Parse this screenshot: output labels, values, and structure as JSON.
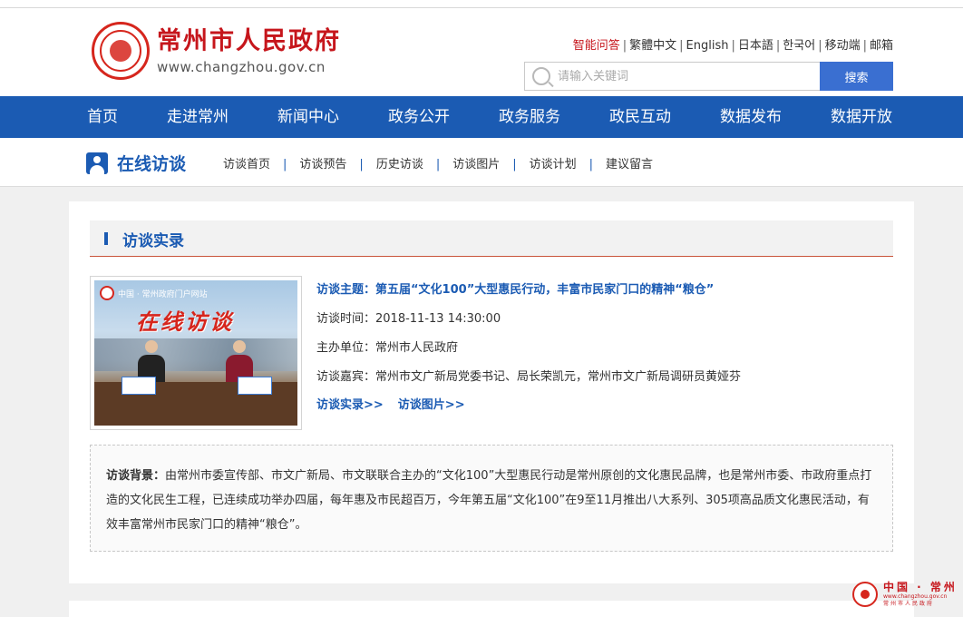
{
  "site": {
    "title_cn": "常州市人民政府",
    "url": "www.changzhou.gov.cn"
  },
  "toplinks": [
    "智能问答",
    "繁體中文",
    "English",
    "日本語",
    "한국어",
    "移动端",
    "邮箱"
  ],
  "search": {
    "placeholder": "请输入关键词",
    "button": "搜索"
  },
  "nav": [
    "首页",
    "走进常州",
    "新闻中心",
    "政务公开",
    "政务服务",
    "政民互动",
    "数据发布",
    "数据开放"
  ],
  "subbar": {
    "title": "在线访谈",
    "items": [
      "访谈首页",
      "访谈预告",
      "历史访谈",
      "访谈图片",
      "访谈计划",
      "建议留言"
    ]
  },
  "section": {
    "title": "访谈实录"
  },
  "thumbnail": {
    "site_label": "中国 · 常州政府门户网站",
    "banner": "在线访谈"
  },
  "interview": {
    "topic_label": "访谈主题：",
    "topic": "第五届“文化100”大型惠民行动，丰富市民家门口的精神“粮仓”",
    "time_label": "访谈时间：",
    "time": "2018-11-13 14:30:00",
    "host_label": "主办单位：",
    "host": "常州市人民政府",
    "guests_label": "访谈嘉宾：",
    "guests": "常州市文广新局党委书记、局长荣凯元，常州市文广新局调研员黄娅芬",
    "link_record": "访谈实录>>",
    "link_photos": "访谈图片>>"
  },
  "background": {
    "label": "访谈背景：",
    "text": "由常州市委宣传部、市文广新局、市文联联合主办的“文化100”大型惠民行动是常州原创的文化惠民品牌，也是常州市委、市政府重点打造的文化民生工程，已连续成功举办四届，每年惠及市民超百万，今年第五届“文化100”在9至11月推出八大系列、305项高品质文化惠民活动，有效丰富常州市民家门口的精神“粮仓”。"
  },
  "corner": {
    "cn": "中国 · 常州",
    "url": "www.changzhou.gov.cn",
    "sub": "常州市人民政府"
  },
  "colors": {
    "nav_blue": "#1b5bb3",
    "brand_red": "#c6161c",
    "search_button": "#3a6fd1"
  }
}
